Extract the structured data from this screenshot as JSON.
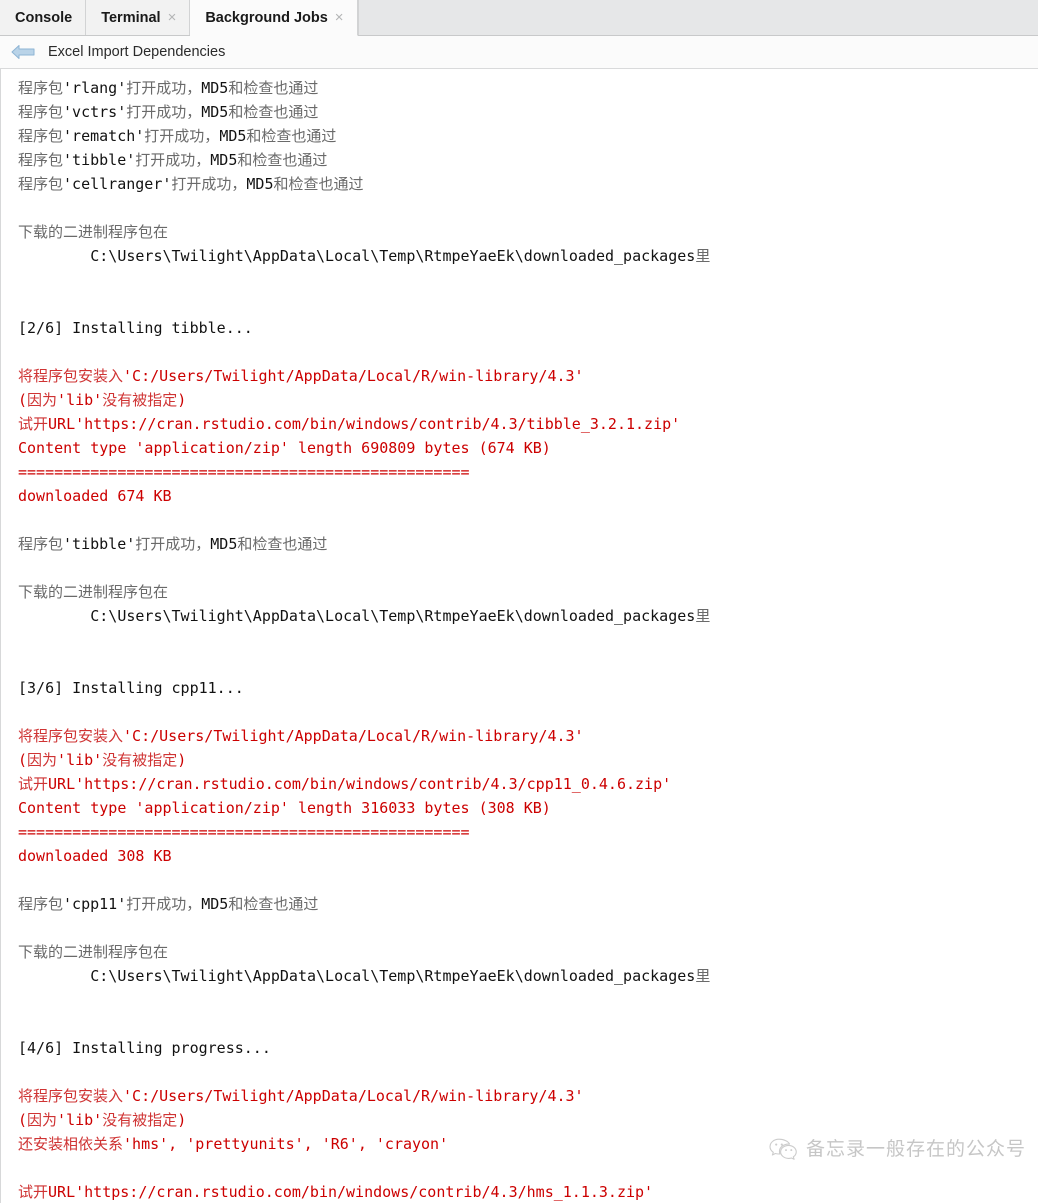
{
  "tabs": [
    {
      "label": "Console",
      "closable": false,
      "active": false
    },
    {
      "label": "Terminal",
      "closable": true,
      "active": false
    },
    {
      "label": "Background Jobs",
      "closable": true,
      "active": true
    }
  ],
  "tab_close_glyph": "×",
  "job_header": {
    "back_icon": "back-arrow-icon",
    "title": "Excel Import Dependencies"
  },
  "colors": {
    "stderr_red": "#cc0000",
    "stdout_gray": "#6a6a6a",
    "stdout_black": "#121212",
    "tab_active_bg": "#fbfbfb",
    "tab_inactive_bg": "#f2f2f2",
    "strip_bg": "#e6e7e8"
  },
  "watermark": {
    "icon": "wechat-icon",
    "text": "备忘录一般存在的公众号"
  },
  "console": {
    "lines": [
      {
        "t": "程序包'rlang'打开成功，MD5和检查也通过",
        "k": "out"
      },
      {
        "t": "程序包'vctrs'打开成功，MD5和检查也通过",
        "k": "out"
      },
      {
        "t": "程序包'rematch'打开成功，MD5和检查也通过",
        "k": "out"
      },
      {
        "t": "程序包'tibble'打开成功，MD5和检查也通过",
        "k": "out"
      },
      {
        "t": "程序包'cellranger'打开成功，MD5和检查也通过",
        "k": "out"
      },
      {
        "t": "",
        "k": "out"
      },
      {
        "t": "下载的二进制程序包在",
        "k": "out"
      },
      {
        "t": "        C:\\Users\\Twilight\\AppData\\Local\\Temp\\RtmpeYaeEk\\downloaded_packages里",
        "k": "out"
      },
      {
        "t": "",
        "k": "out"
      },
      {
        "t": "",
        "k": "out"
      },
      {
        "t": "[2/6] Installing tibble...",
        "k": "out"
      },
      {
        "t": "",
        "k": "out"
      },
      {
        "t": "将程序包安装入'C:/Users/Twilight/AppData/Local/R/win-library/4.3'",
        "k": "err"
      },
      {
        "t": "(因为'lib'没有被指定)",
        "k": "err"
      },
      {
        "t": "试开URL'https://cran.rstudio.com/bin/windows/contrib/4.3/tibble_3.2.1.zip'",
        "k": "err"
      },
      {
        "t": "Content type 'application/zip' length 690809 bytes (674 KB)",
        "k": "err"
      },
      {
        "t": "==================================================",
        "k": "err"
      },
      {
        "t": "downloaded 674 KB",
        "k": "err"
      },
      {
        "t": "",
        "k": "out"
      },
      {
        "t": "程序包'tibble'打开成功，MD5和检查也通过",
        "k": "out"
      },
      {
        "t": "",
        "k": "out"
      },
      {
        "t": "下载的二进制程序包在",
        "k": "out"
      },
      {
        "t": "        C:\\Users\\Twilight\\AppData\\Local\\Temp\\RtmpeYaeEk\\downloaded_packages里",
        "k": "out"
      },
      {
        "t": "",
        "k": "out"
      },
      {
        "t": "",
        "k": "out"
      },
      {
        "t": "[3/6] Installing cpp11...",
        "k": "out"
      },
      {
        "t": "",
        "k": "out"
      },
      {
        "t": "将程序包安装入'C:/Users/Twilight/AppData/Local/R/win-library/4.3'",
        "k": "err"
      },
      {
        "t": "(因为'lib'没有被指定)",
        "k": "err"
      },
      {
        "t": "试开URL'https://cran.rstudio.com/bin/windows/contrib/4.3/cpp11_0.4.6.zip'",
        "k": "err"
      },
      {
        "t": "Content type 'application/zip' length 316033 bytes (308 KB)",
        "k": "err"
      },
      {
        "t": "==================================================",
        "k": "err"
      },
      {
        "t": "downloaded 308 KB",
        "k": "err"
      },
      {
        "t": "",
        "k": "out"
      },
      {
        "t": "程序包'cpp11'打开成功，MD5和检查也通过",
        "k": "out"
      },
      {
        "t": "",
        "k": "out"
      },
      {
        "t": "下载的二进制程序包在",
        "k": "out"
      },
      {
        "t": "        C:\\Users\\Twilight\\AppData\\Local\\Temp\\RtmpeYaeEk\\downloaded_packages里",
        "k": "out"
      },
      {
        "t": "",
        "k": "out"
      },
      {
        "t": "",
        "k": "out"
      },
      {
        "t": "[4/6] Installing progress...",
        "k": "out"
      },
      {
        "t": "",
        "k": "out"
      },
      {
        "t": "将程序包安装入'C:/Users/Twilight/AppData/Local/R/win-library/4.3'",
        "k": "err"
      },
      {
        "t": "(因为'lib'没有被指定)",
        "k": "err"
      },
      {
        "t": "还安装相依关系'hms', 'prettyunits', 'R6', 'crayon'",
        "k": "err"
      },
      {
        "t": "",
        "k": "out"
      },
      {
        "t": "试开URL'https://cran.rstudio.com/bin/windows/contrib/4.3/hms_1.1.3.zip'",
        "k": "err"
      }
    ]
  }
}
